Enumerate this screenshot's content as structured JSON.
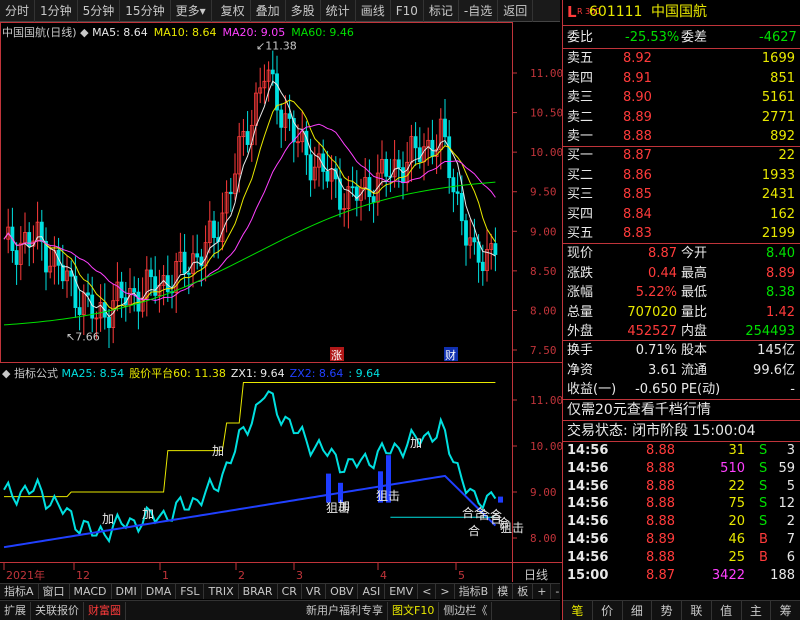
{
  "toolbar": {
    "items": [
      "分时",
      "1分钟",
      "5分钟",
      "15分钟",
      "更多",
      "复权",
      "叠加",
      "多股",
      "统计",
      "画线",
      "F10",
      "标记",
      "-自选",
      "返回"
    ],
    "more_arrow": "▾"
  },
  "main_chart": {
    "title": "中国国航(日线)",
    "ma_labels": [
      {
        "text": "MA5: 8.64",
        "color": "#e8e8e8"
      },
      {
        "text": "MA10: 8.64",
        "color": "#e8e800"
      },
      {
        "text": "MA20: 9.05",
        "color": "#ff40ff"
      },
      {
        "text": "MA60: 9.46",
        "color": "#00e000"
      }
    ],
    "y_ticks": [
      "11.00",
      "10.50",
      "10.00",
      "9.50",
      "9.00",
      "8.50",
      "8.00",
      "7.50"
    ],
    "high_label": "11.38",
    "low_label": "7.66",
    "badge_up": "涨",
    "badge_fin": "财"
  },
  "indicator_chart": {
    "title": "指标公式",
    "labels": [
      {
        "text": "MA25: 8.54",
        "color": "#00e0e0"
      },
      {
        "text": "股价平台60: 11.38",
        "color": "#e8e800"
      },
      {
        "text": "ZX1: 9.64",
        "color": "#e8e8e8"
      },
      {
        "text": "ZX2: 8.64",
        "color": "#2040ff"
      },
      {
        "text": ": 9.64",
        "color": "#00e0e0"
      }
    ],
    "y_ticks": [
      "11.00",
      "10.00",
      "9.00",
      "8.00"
    ],
    "signals": [
      "加",
      "加",
      "加",
      "加",
      "狙击",
      "狙击",
      "加",
      "合合",
      "合",
      "合合",
      "合",
      "合",
      "狙击"
    ]
  },
  "x_axis": {
    "labels": [
      "2021年",
      "12",
      "1",
      "2",
      "3",
      "4",
      "5"
    ],
    "period": "日线"
  },
  "bottom_tabs1": [
    "指标A",
    "窗口",
    "MACD",
    "DMI",
    "DMA",
    "FSL",
    "TRIX",
    "BRAR",
    "CR",
    "VR",
    "OBV",
    "ASI",
    "EMV",
    "<",
    ">",
    "指标B",
    "模",
    "板",
    "+",
    "-"
  ],
  "bottom_tabs2": [
    "扩展",
    "关联报价",
    "财富圈",
    "新用户福利专享",
    "图文F10",
    "侧边栏《"
  ],
  "quote": {
    "marker": "L",
    "code_prefix": "R 300",
    "code": "601111",
    "name": "中国国航",
    "weibi_label": "委比",
    "weibi": "-25.53%",
    "weicha_label": "委差",
    "weicha": "-4627",
    "sells": [
      {
        "label": "卖五",
        "price": "8.92",
        "vol": "1699"
      },
      {
        "label": "卖四",
        "price": "8.91",
        "vol": "851"
      },
      {
        "label": "卖三",
        "price": "8.90",
        "vol": "5161"
      },
      {
        "label": "卖二",
        "price": "8.89",
        "vol": "2771"
      },
      {
        "label": "卖一",
        "price": "8.88",
        "vol": "892"
      }
    ],
    "buys": [
      {
        "label": "买一",
        "price": "8.87",
        "vol": "22"
      },
      {
        "label": "买二",
        "price": "8.86",
        "vol": "1933"
      },
      {
        "label": "买三",
        "price": "8.85",
        "vol": "2431"
      },
      {
        "label": "买四",
        "price": "8.84",
        "vol": "162"
      },
      {
        "label": "买五",
        "price": "8.83",
        "vol": "2199"
      }
    ],
    "stats1": [
      {
        "l1": "现价",
        "v1": "8.87",
        "c1": "red",
        "l2": "今开",
        "v2": "8.40",
        "c2": "grn"
      },
      {
        "l1": "涨跌",
        "v1": "0.44",
        "c1": "red",
        "l2": "最高",
        "v2": "8.89",
        "c2": "red"
      },
      {
        "l1": "涨幅",
        "v1": "5.22%",
        "c1": "red",
        "l2": "最低",
        "v2": "8.38",
        "c2": "grn"
      },
      {
        "l1": "总量",
        "v1": "707020",
        "c1": "yel",
        "l2": "量比",
        "v2": "1.42",
        "c2": "red"
      },
      {
        "l1": "外盘",
        "v1": "452527",
        "c1": "red",
        "l2": "内盘",
        "v2": "254493",
        "c2": "grn"
      }
    ],
    "stats2": [
      {
        "l1": "换手",
        "v1": "0.71%",
        "l2": "股本",
        "v2": "145亿"
      },
      {
        "l1": "净资",
        "v1": "3.61",
        "l2": "流通",
        "v2": "99.6亿"
      },
      {
        "l1": "收益(一)",
        "v1": "-0.650",
        "l2": "PE(动)",
        "v2": "-"
      }
    ],
    "promo": "仅需20元查看千档行情",
    "trade_status": "交易状态: 闭市阶段 15:00:04",
    "ticks": [
      {
        "t": "14:56",
        "p": "8.88",
        "v": "31",
        "vc": "yel",
        "bs": "S",
        "n": "3"
      },
      {
        "t": "14:56",
        "p": "8.88",
        "v": "510",
        "vc": "mag",
        "bs": "S",
        "n": "59"
      },
      {
        "t": "14:56",
        "p": "8.88",
        "v": "22",
        "vc": "yel",
        "bs": "S",
        "n": "5"
      },
      {
        "t": "14:56",
        "p": "8.88",
        "v": "75",
        "vc": "yel",
        "bs": "S",
        "n": "12"
      },
      {
        "t": "14:56",
        "p": "8.88",
        "v": "20",
        "vc": "yel",
        "bs": "S",
        "n": "2"
      },
      {
        "t": "14:56",
        "p": "8.89",
        "v": "46",
        "vc": "yel",
        "bs": "B",
        "n": "7"
      },
      {
        "t": "14:56",
        "p": "8.88",
        "v": "25",
        "vc": "yel",
        "bs": "B",
        "n": "6"
      },
      {
        "t": "15:00",
        "p": "8.87",
        "v": "3422",
        "vc": "mag",
        "bs": "",
        "n": "188"
      }
    ],
    "tabs": [
      "笔",
      "价",
      "细",
      "势",
      "联",
      "值",
      "主",
      "筹"
    ]
  },
  "colors": {
    "up": "#ff3b3b",
    "down": "#00e0e0",
    "axis": "#c0343a",
    "ma5": "#e8e8e8",
    "ma10": "#e8e800",
    "ma20": "#ff40ff",
    "ma60": "#00e000"
  }
}
